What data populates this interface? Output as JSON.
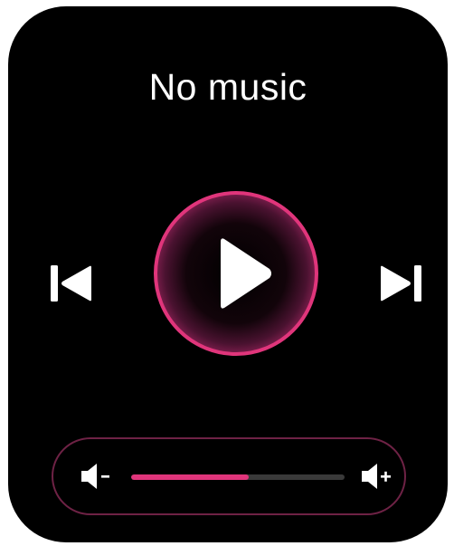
{
  "player": {
    "title": "No music"
  },
  "controls": {
    "prev_icon": "skip-previous-icon",
    "play_icon": "play-icon",
    "next_icon": "skip-next-icon"
  },
  "volume": {
    "down_icon": "volume-down-icon",
    "up_icon": "volume-up-icon",
    "level_percent": 55
  },
  "colors": {
    "accent": "#e0357b",
    "ring": "#c8306e",
    "background": "#000000",
    "foreground": "#ffffff"
  }
}
